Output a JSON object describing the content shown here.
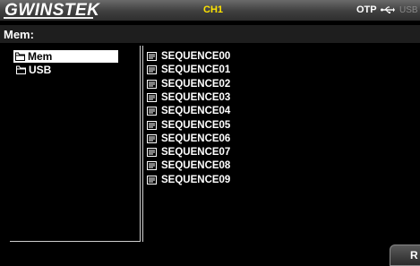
{
  "header": {
    "logo_text": "GWINSTEK",
    "channel": "CH1",
    "otp": "OTP",
    "usb_label": "USB",
    "channel_color": "#ffe400"
  },
  "path": {
    "label": "Mem:"
  },
  "folders": [
    {
      "label": "Mem",
      "selected": true
    },
    {
      "label": "USB",
      "selected": false
    }
  ],
  "files": [
    "SEQUENCE00",
    "SEQUENCE01",
    "SEQUENCE02",
    "SEQUENCE03",
    "SEQUENCE04",
    "SEQUENCE05",
    "SEQUENCE06",
    "SEQUENCE07",
    "SEQUENCE08",
    "SEQUENCE09"
  ],
  "softkey": {
    "label": "R"
  }
}
